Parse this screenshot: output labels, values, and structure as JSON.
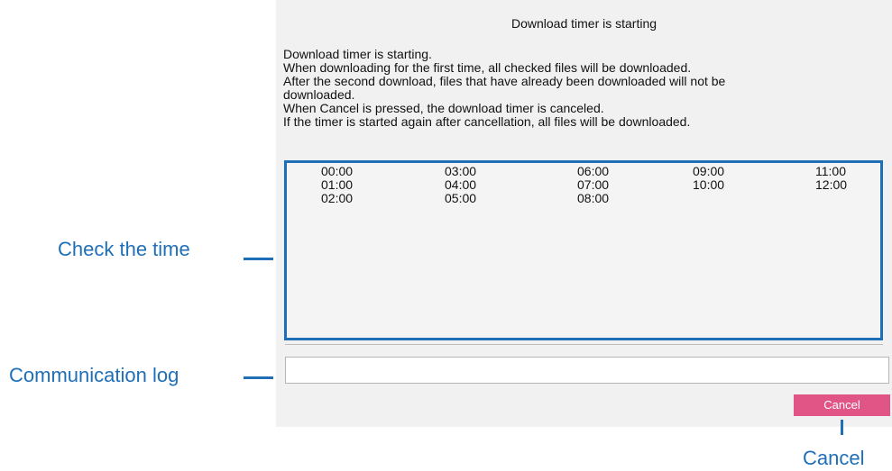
{
  "dialog": {
    "title": "Download timer is starting",
    "message_lines": [
      "Download timer is starting.",
      "When downloading for the first time, all checked files will be downloaded.",
      "After the second download, files that have already been downloaded will not be",
      "downloaded.",
      "When Cancel is pressed, the download timer is canceled.",
      "If the timer is started again after cancellation, all files will be downloaded."
    ],
    "times": [
      [
        "00:00",
        "01:00",
        "02:00"
      ],
      [
        "03:00",
        "04:00",
        "05:00"
      ],
      [
        "06:00",
        "07:00",
        "08:00"
      ],
      [
        "09:00",
        "10:00"
      ],
      [
        "11:00",
        "12:00"
      ]
    ],
    "communication_log": "",
    "cancel_label": "Cancel"
  },
  "annotations": {
    "check_time": "Check the time",
    "communication_log": "Communication log",
    "cancel": "Cancel"
  },
  "colors": {
    "accent": "#1f6fb8",
    "cancel_button": "#e05585",
    "dialog_bg": "#f1f1f1"
  }
}
